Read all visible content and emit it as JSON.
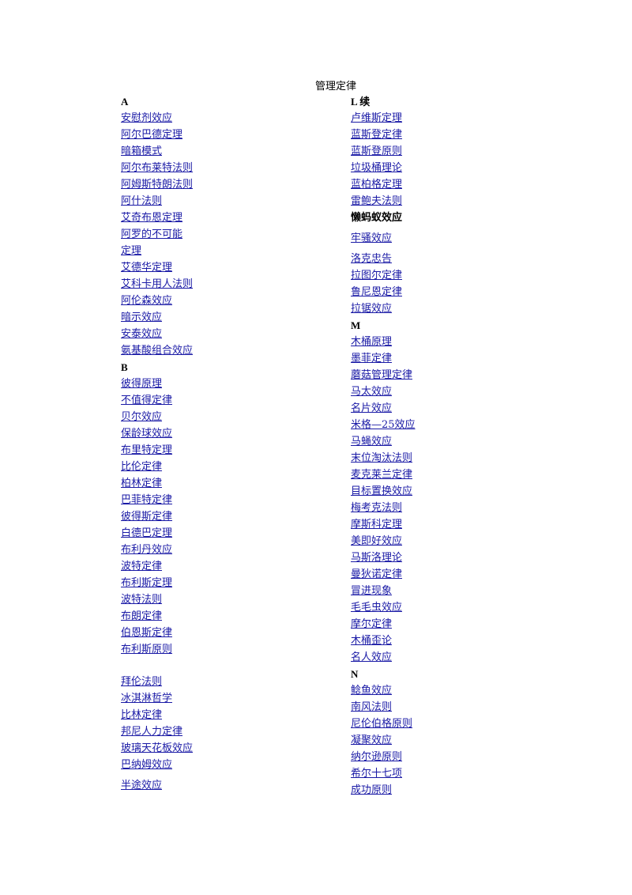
{
  "page": {
    "title": "管理定律",
    "link_color": "#1a1aa6"
  },
  "left_column": {
    "header_a": "A",
    "a_items": [
      "安慰剂效应",
      "阿尔巴德定理",
      "暗箱模式",
      "阿尔布莱特法则",
      "阿姆斯特朗法则",
      "阿什法则",
      "艾奇布恩定理",
      "阿罗的不可能",
      "定理",
      "艾德华定理",
      "艾科卡用人法则",
      "阿伦森效应",
      "暗示效应",
      "安泰效应",
      "氨基酸组合效应"
    ],
    "header_b": "B",
    "b_items": [
      "彼得原理",
      "不值得定律",
      "贝尔效应",
      "保龄球效应",
      "布里特定理",
      "比伦定律",
      "柏林定律",
      "巴菲特定律",
      "彼得斯定律",
      "白德巴定理",
      "布利丹效应",
      "波特定律",
      "布利斯定理",
      "波特法则",
      "布朗定律",
      "伯恩斯定律",
      "布利斯原则"
    ],
    "b_items_2": [
      "拜伦法则",
      "冰淇淋哲学",
      "比林定律",
      "邦尼人力定律",
      "玻璃天花板效应",
      "巴纳姆效应"
    ],
    "last_item": "半途效应"
  },
  "right_column": {
    "header_l": "L 续",
    "l_items": [
      "卢维斯定理",
      "蓝斯登定律",
      "蓝斯登原则",
      "垃圾桶理论",
      "蓝柏格定理",
      "雷鲍夫法则"
    ],
    "l_plain": "懒蚂蚁效应",
    "l_items_2": [
      "牢骚效应"
    ],
    "l_items_3": [
      "洛克忠告",
      "拉图尔定律",
      "鲁尼恩定律",
      "拉锯效应"
    ],
    "header_m": "M",
    "m_items": [
      "木桶原理",
      "墨菲定律",
      "蘑菇管理定律",
      "马太效应",
      "名片效应",
      "米格—25效应",
      "马蝇效应",
      "末位淘汰法则",
      "麦克莱兰定律",
      "目标置换效应",
      "梅考克法则",
      "摩斯科定理",
      "美即好效应",
      "马斯洛理论",
      "曼狄诺定律",
      "冒进现象",
      "毛毛虫效应",
      "摩尔定律",
      "木桶歪论",
      "名人效应"
    ],
    "header_n": "N",
    "n_items": [
      "鲶鱼效应",
      "南风法则",
      "尼伦伯格原则",
      "凝聚效应",
      "纳尔逊原则",
      "希尔十七项",
      "成功原则"
    ]
  }
}
